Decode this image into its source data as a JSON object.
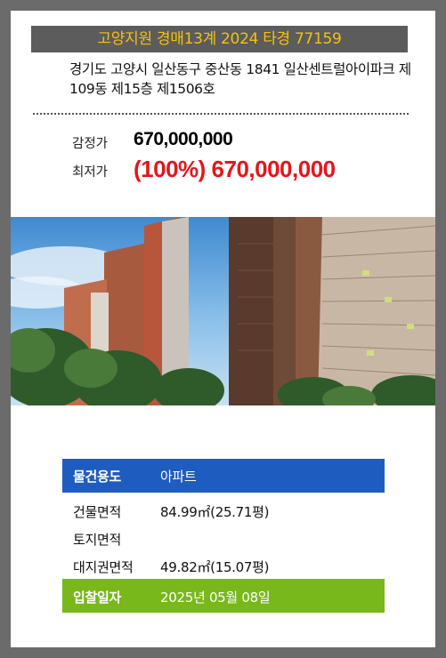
{
  "header": {
    "title": "고양지원 경매13계 2024 타경 77159"
  },
  "property": {
    "address": "경기도 고양시 일산동구 중산동 1841 일산센트럴아이파크 제109동 제15층 제1506호"
  },
  "prices": {
    "appraisal_label": "감정가",
    "appraisal_value": "670,000,000",
    "minimum_label": "최저가",
    "minimum_value": "(100%) 670,000,000"
  },
  "details": {
    "rows": [
      {
        "label": "물건용도",
        "value": "아파트"
      },
      {
        "label": "건물면적",
        "value": "84.99㎡(25.71평)"
      },
      {
        "label": "토지면적",
        "value": ""
      },
      {
        "label": "대지권면적",
        "value": "49.82㎡(15.07평)"
      },
      {
        "label": "입찰일자",
        "value": "2025년 05월 08일"
      }
    ]
  },
  "colors": {
    "title_bg": "#5c5c5c",
    "title_text": "#f4c20d",
    "min_price": "#e8141b",
    "usage_row": "#1f5cbf",
    "bid_row": "#78b81a"
  }
}
